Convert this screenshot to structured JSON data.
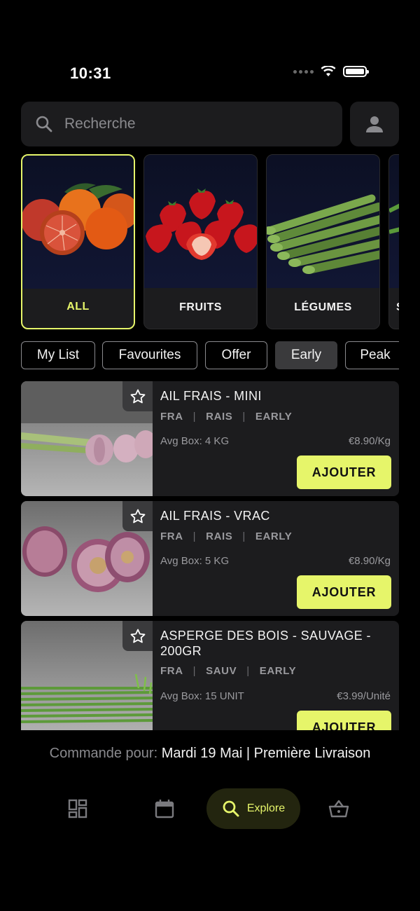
{
  "status_bar": {
    "time": "10:31"
  },
  "search": {
    "placeholder": "Recherche"
  },
  "categories": [
    {
      "label": "ALL",
      "active": true
    },
    {
      "label": "FRUITS",
      "active": false
    },
    {
      "label": "LÉGUMES",
      "active": false
    },
    {
      "label": "S",
      "active": false
    }
  ],
  "filters": [
    "My List",
    "Favourites",
    "Offer",
    "Early",
    "Peak"
  ],
  "selected_filter": "Early",
  "products": [
    {
      "name": "AIL FRAIS - MINI",
      "origin": "FRA",
      "variety": "RAIS",
      "season": "EARLY",
      "avg_box": "Avg Box: 4 KG",
      "price": "€8.90/Kg",
      "button": "AJOUTER"
    },
    {
      "name": "AIL FRAIS - VRAC",
      "origin": "FRA",
      "variety": "RAIS",
      "season": "EARLY",
      "avg_box": "Avg Box: 5 KG",
      "price": "€8.90/Kg",
      "button": "AJOUTER"
    },
    {
      "name": "ASPERGE DES BOIS - SAUVAGE - 200GR",
      "origin": "FRA",
      "variety": "SAUV",
      "season": "EARLY",
      "avg_box": "Avg Box: 15 UNIT",
      "price": "€3.99/Unité",
      "button": "AJOUTER"
    }
  ],
  "order": {
    "label": "Commande pour:",
    "value": "Mardi 19 Mai | Première Livraison"
  },
  "tabbar": {
    "explore_label": "Explore"
  },
  "colors": {
    "accent": "#e6f56a",
    "card": "#1c1c1e",
    "background": "#000000"
  }
}
